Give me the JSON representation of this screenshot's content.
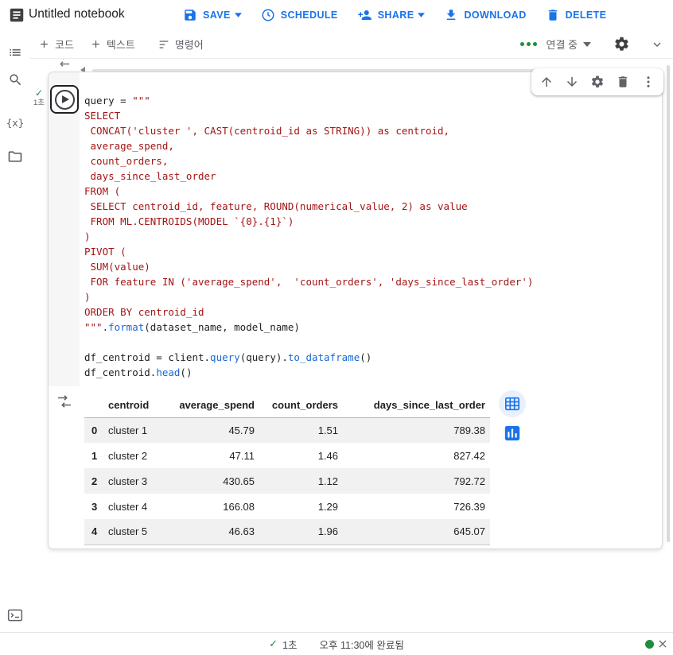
{
  "colors": {
    "accent": "#1a73e8",
    "code_string": "#a31515",
    "code_func": "#1967d2",
    "success": "#1e8e3e",
    "icon_gray": "#5f6368"
  },
  "header": {
    "title": "Untitled notebook",
    "save_label": "SAVE",
    "schedule_label": "SCHEDULE",
    "share_label": "SHARE",
    "download_label": "DOWNLOAD",
    "delete_label": "DELETE"
  },
  "toolbar": {
    "add_code_label": "코드",
    "add_text_label": "텍스트",
    "commands_label": "명령어",
    "connect_status": "연결 중"
  },
  "sidebar": {
    "vars_label": "{x}"
  },
  "cell": {
    "exec_check": "✓",
    "exec_time": "1초",
    "code_lines": [
      [
        {
          "t": "query = ",
          "c": "p"
        },
        {
          "t": "\"\"\"",
          "c": "s"
        }
      ],
      [
        {
          "t": "SELECT",
          "c": "s"
        }
      ],
      [
        {
          "t": " CONCAT('cluster ', CAST(centroid_id as STRING)) as centroid,",
          "c": "s"
        }
      ],
      [
        {
          "t": " average_spend,",
          "c": "s"
        }
      ],
      [
        {
          "t": " count_orders,",
          "c": "s"
        }
      ],
      [
        {
          "t": " days_since_last_order",
          "c": "s"
        }
      ],
      [
        {
          "t": "FROM (",
          "c": "s"
        }
      ],
      [
        {
          "t": " SELECT centroid_id, feature, ROUND(numerical_value, 2) as value",
          "c": "s"
        }
      ],
      [
        {
          "t": " FROM ML.CENTROIDS(MODEL `{0}.{1}`)",
          "c": "s"
        }
      ],
      [
        {
          "t": ")",
          "c": "s"
        }
      ],
      [
        {
          "t": "PIVOT (",
          "c": "s"
        }
      ],
      [
        {
          "t": " SUM(value)",
          "c": "s"
        }
      ],
      [
        {
          "t": " FOR feature IN ('average_spend',  'count_orders', 'days_since_last_order')",
          "c": "s"
        }
      ],
      [
        {
          "t": ")",
          "c": "s"
        }
      ],
      [
        {
          "t": "ORDER BY centroid_id",
          "c": "s"
        }
      ],
      [
        {
          "t": "\"\"\"",
          "c": "s"
        },
        {
          "t": ".",
          "c": "p"
        },
        {
          "t": "format",
          "c": "f"
        },
        {
          "t": "(dataset_name, model_name)",
          "c": "p"
        }
      ],
      [],
      [
        {
          "t": "df_centroid = client.",
          "c": "p"
        },
        {
          "t": "query",
          "c": "f"
        },
        {
          "t": "(query).",
          "c": "p"
        },
        {
          "t": "to_dataframe",
          "c": "f"
        },
        {
          "t": "()",
          "c": "p"
        }
      ],
      [
        {
          "t": "df_centroid.",
          "c": "p"
        },
        {
          "t": "head",
          "c": "f"
        },
        {
          "t": "()",
          "c": "p"
        }
      ]
    ]
  },
  "output": {
    "table": {
      "columns": [
        "centroid",
        "average_spend",
        "count_orders",
        "days_since_last_order"
      ],
      "rows": [
        [
          "0",
          "cluster 1",
          "45.79",
          "1.51",
          "789.38"
        ],
        [
          "1",
          "cluster 2",
          "47.11",
          "1.46",
          "827.42"
        ],
        [
          "2",
          "cluster 3",
          "430.65",
          "1.12",
          "792.72"
        ],
        [
          "3",
          "cluster 4",
          "166.08",
          "1.29",
          "726.39"
        ],
        [
          "4",
          "cluster 5",
          "46.63",
          "1.96",
          "645.07"
        ]
      ]
    }
  },
  "statusbar": {
    "check": "✓",
    "duration": "1초",
    "completed_message": "오후 11:30에 완료됨"
  }
}
